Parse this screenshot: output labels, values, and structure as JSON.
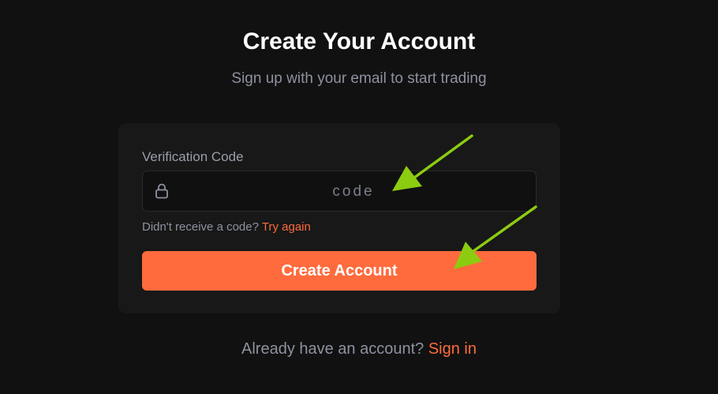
{
  "header": {
    "title": "Create Your Account",
    "subtitle": "Sign up with your email to start trading"
  },
  "form": {
    "label": "Verification Code",
    "input_placeholder": "code",
    "input_value": "",
    "lock_icon": "lock-icon",
    "resend_prompt": "Didn't receive a code?",
    "resend_link": "Try again",
    "submit_label": "Create Account"
  },
  "footer": {
    "prompt": "Already have an account?",
    "link": "Sign in"
  },
  "colors": {
    "background": "#111111",
    "card": "#181818",
    "accent": "#ff6b3d",
    "annotation_arrow": "#8ccc10"
  }
}
